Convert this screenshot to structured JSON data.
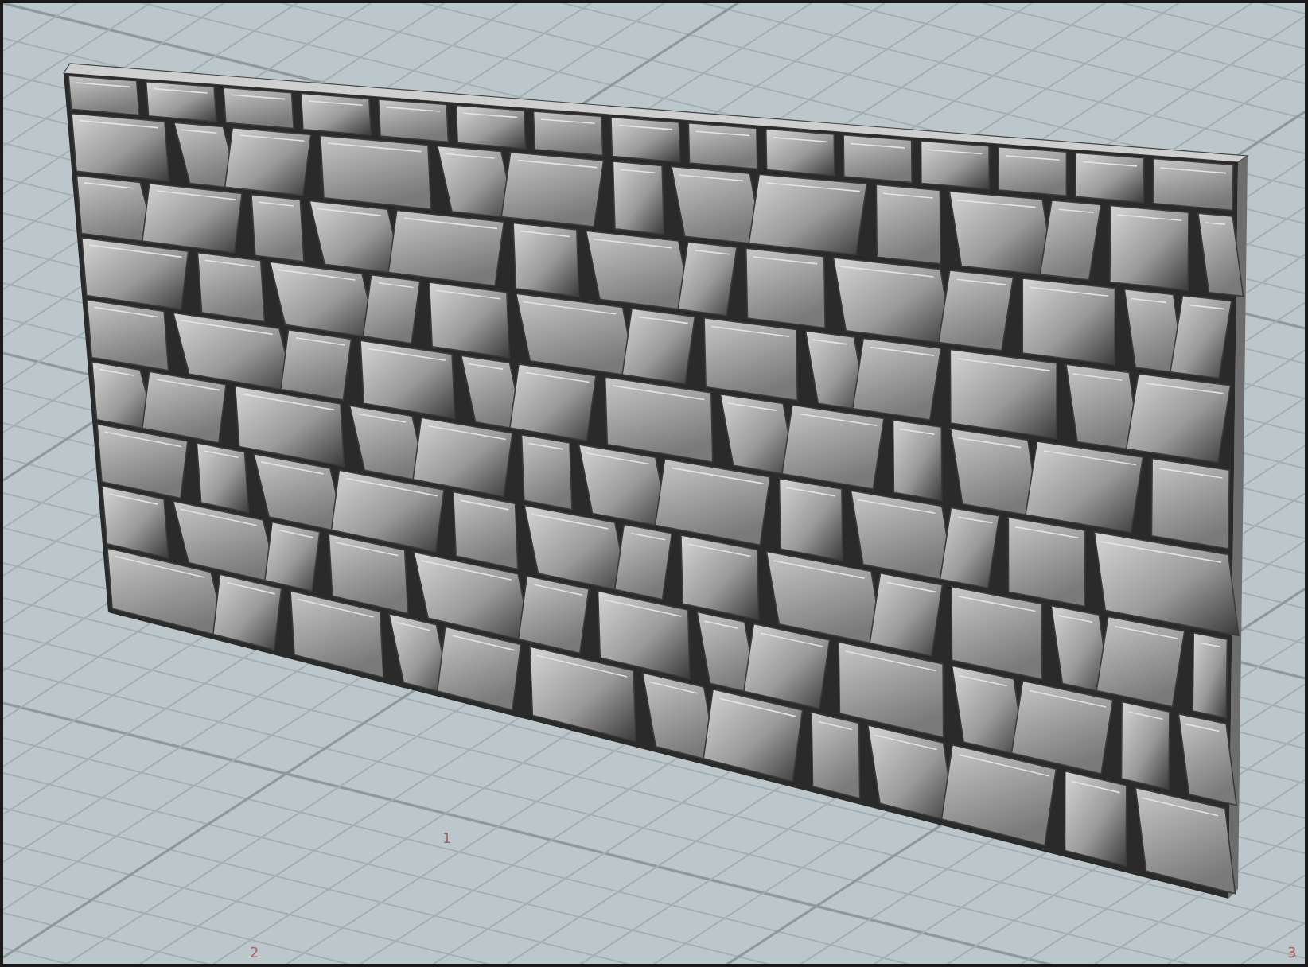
{
  "viewport": {
    "grid_labels": [
      {
        "text": "1"
      },
      {
        "text": "2"
      },
      {
        "text": "3"
      }
    ]
  }
}
